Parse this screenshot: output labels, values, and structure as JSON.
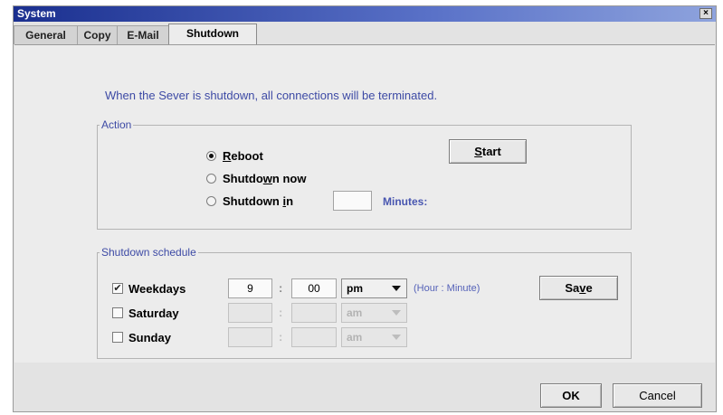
{
  "window": {
    "title": "System",
    "close_glyph": "×"
  },
  "tabs": [
    {
      "label": "General"
    },
    {
      "label": "Copy"
    },
    {
      "label": "E-Mail"
    },
    {
      "label": "Shutdown",
      "selected": true
    }
  ],
  "info_text": "When the Sever is shutdown, all connections will be terminated.",
  "action": {
    "legend": "Action",
    "options": [
      {
        "pre": "",
        "u": "R",
        "post": "eboot",
        "checked": true
      },
      {
        "pre": "Shutdo",
        "u": "w",
        "post": "n now",
        "checked": false
      },
      {
        "pre": "Shutdown ",
        "u": "i",
        "post": "n",
        "checked": false
      }
    ],
    "minutes_value": "",
    "minutes_label": "Minutes:",
    "start_button": {
      "u": "S",
      "post": "tart"
    }
  },
  "schedule": {
    "legend": "Shutdown schedule",
    "rows": [
      {
        "label": "Weekdays",
        "checked": true,
        "hour": "9",
        "minute": "00",
        "ampm": "pm",
        "enabled": true
      },
      {
        "label": "Saturday",
        "checked": false,
        "hour": "",
        "minute": "",
        "ampm": "am",
        "enabled": false
      },
      {
        "label": "Sunday",
        "checked": false,
        "hour": "",
        "minute": "",
        "ampm": "am",
        "enabled": false
      }
    ],
    "colon": ":",
    "hint": "(Hour : Minute)",
    "save_button": {
      "pre": "Sa",
      "u": "v",
      "post": "e"
    },
    "check_glyph": "✔"
  },
  "footer": {
    "ok_label": "OK",
    "cancel_label": "Cancel"
  },
  "colors": {
    "title_bar": "#1a2f8f",
    "accent_text": "#3d4aa5",
    "panel_bg": "#ececec"
  }
}
